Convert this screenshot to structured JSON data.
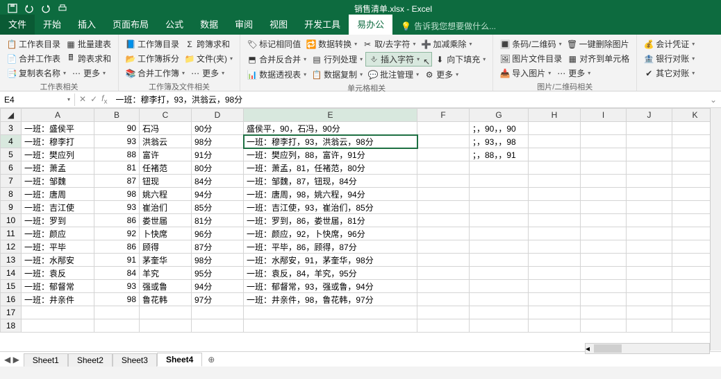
{
  "title": "销售清单.xlsx - Excel",
  "tabs": {
    "file": "文件",
    "home": "开始",
    "insert": "插入",
    "layout": "页面布局",
    "formula": "公式",
    "data": "数据",
    "review": "审阅",
    "view": "视图",
    "dev": "开发工具",
    "yi": "易办公"
  },
  "tellme": "告诉我您想要做什么...",
  "ribbon": {
    "g1": {
      "label": "工作表相关",
      "a": "工作表目录",
      "b": "批量建表",
      "c": "合并工作表",
      "d": "跨表求和",
      "e": "复制表名称",
      "f": "更多"
    },
    "g2": {
      "label": "工作簿及文件相关",
      "a": "工作簿目录",
      "b": "跨簿求和",
      "c": "工作簿拆分",
      "d": "文件(夹)",
      "e": "合并工作簿",
      "f": "更多"
    },
    "g3": {
      "label": "单元格相关",
      "a": "标记相同值",
      "b": "数据转换",
      "c": "取/去字符",
      "d": "加减乘除",
      "e": "合并反合并",
      "f": "行列处理",
      "g": "插入字符",
      "h": "向下填充",
      "i": "数据透视表",
      "j": "数据复制",
      "k": "批注管理",
      "l": "更多"
    },
    "g4": {
      "label": "图片/二维码相关",
      "a": "条码/二维码",
      "b": "一键删除图片",
      "c": "图片文件目录",
      "d": "对齐到单元格",
      "e": "导入图片",
      "f": "更多"
    },
    "g5": {
      "a": "会计凭证",
      "b": "银行对账",
      "c": "其它对账"
    }
  },
  "namebox": "E4",
  "formula": "一班：穆李打，93，洪翁云，98分",
  "cols": [
    "A",
    "B",
    "C",
    "D",
    "E",
    "F",
    "G",
    "H",
    "I",
    "J",
    "K"
  ],
  "rows": [
    {
      "r": 3,
      "A": "一班：盛侯平",
      "B": "90",
      "C": "石冯",
      "D": "90分",
      "E": "盛侯平，90，石冯，90分",
      "G": "；，90，，90"
    },
    {
      "r": 4,
      "A": "一班：穆李打",
      "B": "93",
      "C": "洪翁云",
      "D": "98分",
      "E": "一班：穆李打，93，洪翁云，98分",
      "G": "；，93，，98"
    },
    {
      "r": 5,
      "A": "一班：樊应列",
      "B": "88",
      "C": "富许",
      "D": "91分",
      "E": "一班：樊应列，88，富许，91分",
      "G": "；，88，，91"
    },
    {
      "r": 6,
      "A": "一班：萧孟",
      "B": "81",
      "C": "任褚范",
      "D": "80分",
      "E": "一班：萧孟，81，任褚范，80分",
      "G": ""
    },
    {
      "r": 7,
      "A": "一班：邹魏",
      "B": "87",
      "C": "钮现",
      "D": "84分",
      "E": "一班：邹魏，87，钮现，84分",
      "G": ""
    },
    {
      "r": 8,
      "A": "一班：唐周",
      "B": "98",
      "C": "姚六程",
      "D": "94分",
      "E": "一班：唐周，98，姚六程，94分",
      "G": ""
    },
    {
      "r": 9,
      "A": "一班：吉江使",
      "B": "93",
      "C": "崔治们",
      "D": "85分",
      "E": "一班：吉江使，93，崔治们，85分",
      "G": ""
    },
    {
      "r": 10,
      "A": "一班：罗到",
      "B": "86",
      "C": "娄世届",
      "D": "81分",
      "E": "一班：罗到，86，娄世届，81分",
      "G": ""
    },
    {
      "r": 11,
      "A": "一班：颜应",
      "B": "92",
      "C": "卜快席",
      "D": "96分",
      "E": "一班：颜应，92，卜快席，96分",
      "G": ""
    },
    {
      "r": 12,
      "A": "一班：平毕",
      "B": "86",
      "C": "顾得",
      "D": "87分",
      "E": "一班：平毕，86，顾得，87分",
      "G": ""
    },
    {
      "r": 13,
      "A": "一班：水邴安",
      "B": "91",
      "C": "茅奎华",
      "D": "98分",
      "E": "一班：水邴安，91，茅奎华，98分",
      "G": ""
    },
    {
      "r": 14,
      "A": "一班：袁反",
      "B": "84",
      "C": "羊究",
      "D": "95分",
      "E": "一班：袁反，84，羊究，95分",
      "G": ""
    },
    {
      "r": 15,
      "A": "一班：郁督常",
      "B": "93",
      "C": "强或鲁",
      "D": "94分",
      "E": "一班：郁督常，93，强或鲁，94分",
      "G": ""
    },
    {
      "r": 16,
      "A": "一班：井亲件",
      "B": "98",
      "C": "鲁花韩",
      "D": "97分",
      "E": "一班：井亲件，98，鲁花韩，97分",
      "G": ""
    },
    {
      "r": 17,
      "A": "",
      "B": "",
      "C": "",
      "D": "",
      "E": "",
      "G": ""
    },
    {
      "r": 18,
      "A": "",
      "B": "",
      "C": "",
      "D": "",
      "E": "",
      "G": ""
    }
  ],
  "sheets": {
    "s1": "Sheet1",
    "s2": "Sheet2",
    "s3": "Sheet3",
    "s4": "Sheet4"
  }
}
